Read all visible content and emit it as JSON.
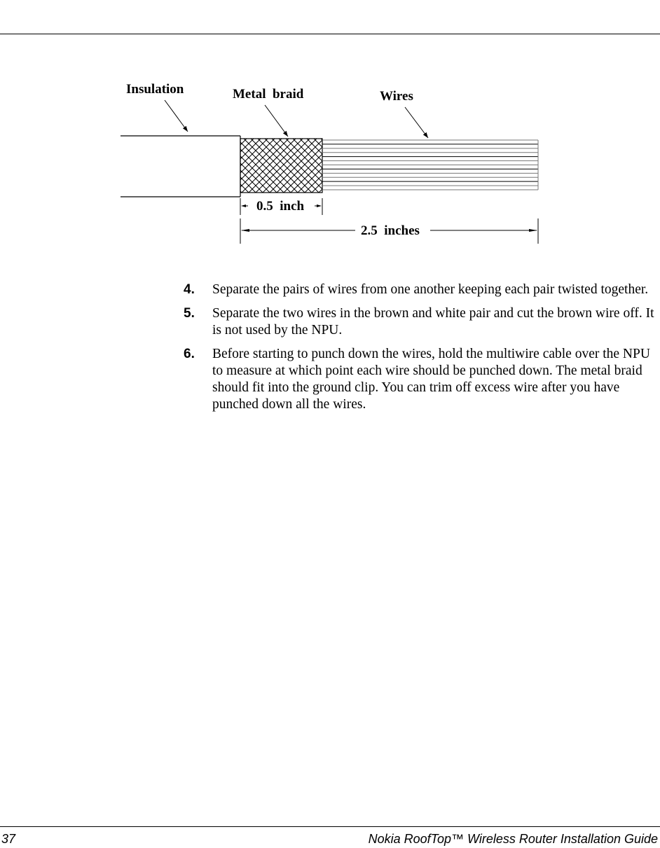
{
  "figure": {
    "labels": {
      "insulation": "Insulation",
      "metal_braid": "Metal  braid",
      "wires": "Wires"
    },
    "dimensions": {
      "braid_length": "0.5  inch",
      "total_length": "2.5  inches"
    }
  },
  "steps": [
    {
      "number": "4.",
      "text": "Separate the pairs of wires from one another keeping each pair twisted together."
    },
    {
      "number": "5.",
      "text": "Separate the two wires in the brown and white pair and cut the brown wire off. It is not used by the NPU."
    },
    {
      "number": "6.",
      "text": "Before starting to punch down the wires, hold the multiwire cable over the NPU to measure at which point each wire should be punched down. The metal braid should fit into the ground clip. You can trim off excess wire after you have punched down all the wires."
    }
  ],
  "footer": {
    "page_number": "37",
    "document_title": "Nokia RoofTop™ Wireless Router Installation Guide"
  }
}
